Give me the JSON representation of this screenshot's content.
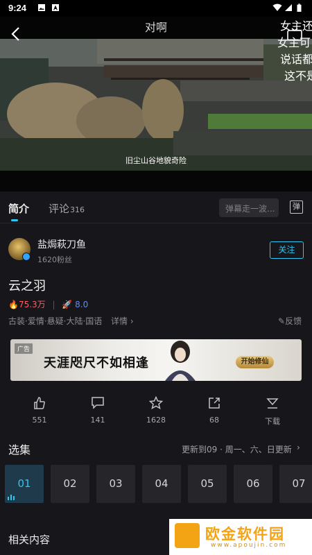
{
  "status_bar": {
    "time": "9:24"
  },
  "video": {
    "title": "对啊",
    "danmaku": [
      "女主还",
      "女主可",
      "说话都",
      "这不是"
    ],
    "subtitle": "旧尘山谷地貌奇险"
  },
  "tabs": {
    "intro": "简介",
    "comments": "评论",
    "comments_count": "316",
    "danmaku_placeholder": "弹幕走一波...",
    "danmaku_toggle": "弹"
  },
  "uploader": {
    "name": "盐焗萩刀鱼",
    "fans": "1620粉丝",
    "follow": "关注"
  },
  "show": {
    "title": "云之羽",
    "heat": "75.3万",
    "score": "8.0",
    "tags": "古装·爱情·悬疑·大陆·国语",
    "detail": "详情",
    "feedback": "反馈"
  },
  "ad": {
    "tag": "广告",
    "headline": "天涯咫尺不如相逢",
    "button": "开始修仙"
  },
  "actions": [
    {
      "name": "like",
      "count": "551"
    },
    {
      "name": "comment",
      "count": "141"
    },
    {
      "name": "favorite",
      "count": "1628"
    },
    {
      "name": "share",
      "count": "68"
    },
    {
      "name": "download",
      "count": "下载"
    }
  ],
  "episodes": {
    "section_title": "选集",
    "update_note": "更新到09 · 周一、六、日更新",
    "items": [
      "01",
      "02",
      "03",
      "04",
      "05",
      "06",
      "07"
    ]
  },
  "related": {
    "section_title": "相关内容"
  },
  "watermark": {
    "text": "欧金软件园",
    "url": "www.apoujin.com"
  },
  "colors": {
    "accent": "#2ec6f4",
    "hot": "#ff5a5f",
    "score": "#5d8df0",
    "background": "#17171b"
  }
}
